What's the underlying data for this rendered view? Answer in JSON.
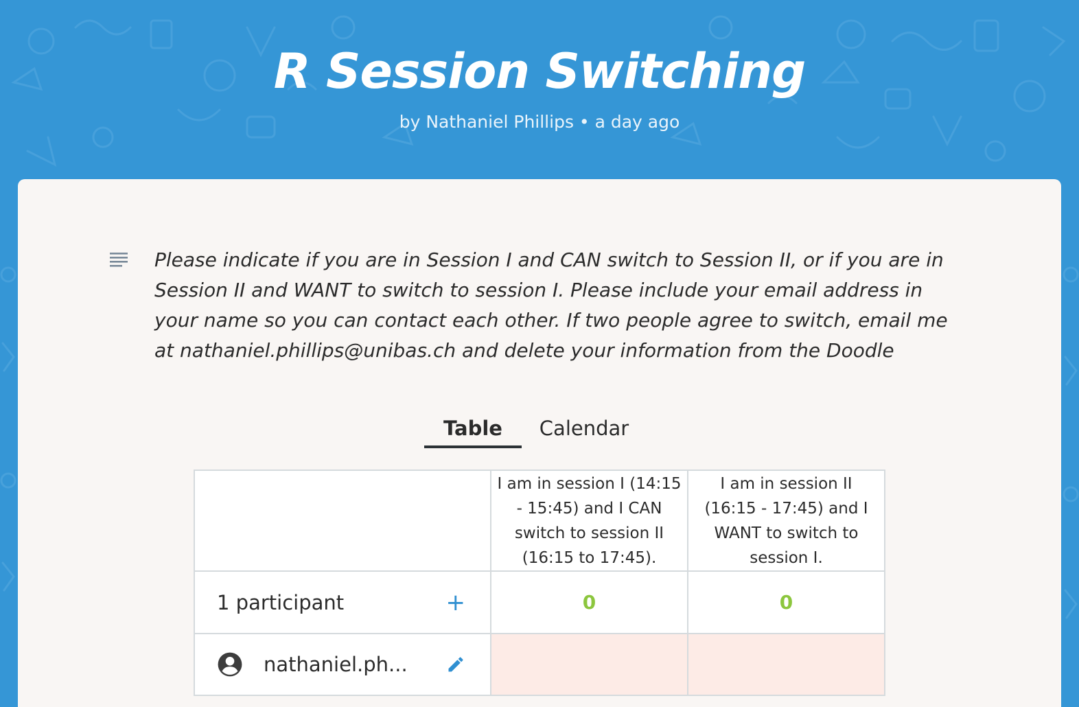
{
  "header": {
    "title": "R Session Switching",
    "byline": "by Nathaniel Phillips • a day ago",
    "background_color": "#3596d6"
  },
  "description": {
    "icon": "notes-lines-icon",
    "text": "Please indicate if you are in Session I and CAN switch to Session II, or if you are in Session II and WANT to switch to session I. Please include your email address in your name so you can contact each other. If two people agree to switch, email me at nathaniel.phillips@unibas.ch and delete your information from the Doodle"
  },
  "tabs": [
    {
      "label": "Table",
      "active": true
    },
    {
      "label": "Calendar",
      "active": false
    }
  ],
  "poll": {
    "options": [
      "I am in session I (14:15 - 15:45) and I CAN switch to session II (16:15 to 17:45).",
      "I am in session II (16:15 - 17:45) and I WANT to switch to session I."
    ],
    "participants_label": "1 participant",
    "add_icon": "plus-icon",
    "counts": [
      "0",
      "0"
    ],
    "count_color": "#8cc63e",
    "participants": [
      {
        "name": "nathaniel.ph...",
        "avatar_icon": "account-circle-icon",
        "edit_icon": "pencil-icon",
        "votes": [
          "",
          ""
        ]
      }
    ]
  }
}
